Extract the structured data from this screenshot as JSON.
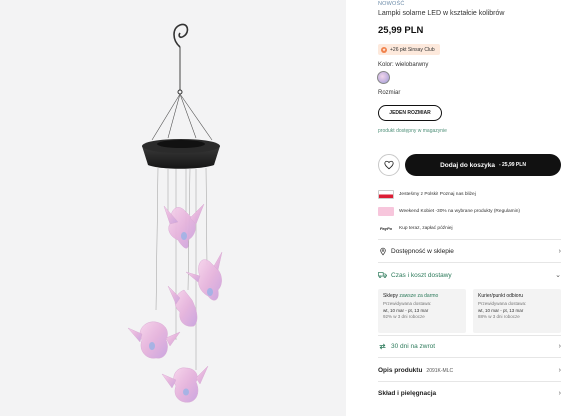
{
  "product": {
    "tag": "NOWOŚĆ",
    "title": "Lampki solarne LED w kształcie kolibrów",
    "price": "25,99 PLN"
  },
  "club": {
    "text": "+26 pkt Sinsay Club",
    "icon": "club-icon"
  },
  "color": {
    "label": "Kolor: wielobarwny"
  },
  "size": {
    "label": "Rozmiar",
    "button": "JEDEN ROZMIAR"
  },
  "stock": "produkt dostępny w magazynie",
  "cart": {
    "label": "Dodaj do koszyka",
    "price": "- 25,99 PLN",
    "wishlist_icon": "heart-icon"
  },
  "promos": [
    {
      "text": "Jesteśmy z Polski! Poznaj nas bliżej",
      "icon": "flag-icon"
    },
    {
      "text": "Weekend Kobiet -30% na wybrane produkty (Regulamin)",
      "icon": "promo-banner-icon"
    },
    {
      "text": "Kup teraz, zapłać później",
      "icon": "paypo-logo",
      "logo_text": "PayPo"
    }
  ],
  "rows": {
    "availability": "Dostępność w sklepie",
    "delivery": "Czas i koszt dostawy",
    "returns": "30 dni na zwrot",
    "description": "Opis produktu",
    "description_code": "2091K-MLC",
    "care": "Skład i pielęgnacja"
  },
  "delivery_boxes": {
    "stores": {
      "title": "Sklepy",
      "title_note": "zawsze za darmo",
      "line1": "Przewidywana dostawa:",
      "line2": "wt, 10 mar - pt, 13 mar",
      "line3": "92% w 3 dni robocze"
    },
    "courier": {
      "title": "Kurier/punkt odbioru",
      "line1": "Przewidywana dostawa:",
      "line2": "wt, 10 mar - pt, 13 mar",
      "line3": "88% w 3 dni robocze"
    }
  },
  "colors": {
    "accent_green": "#2c7a5a",
    "button_black": "#111111",
    "club_bg": "#fde9dc"
  }
}
